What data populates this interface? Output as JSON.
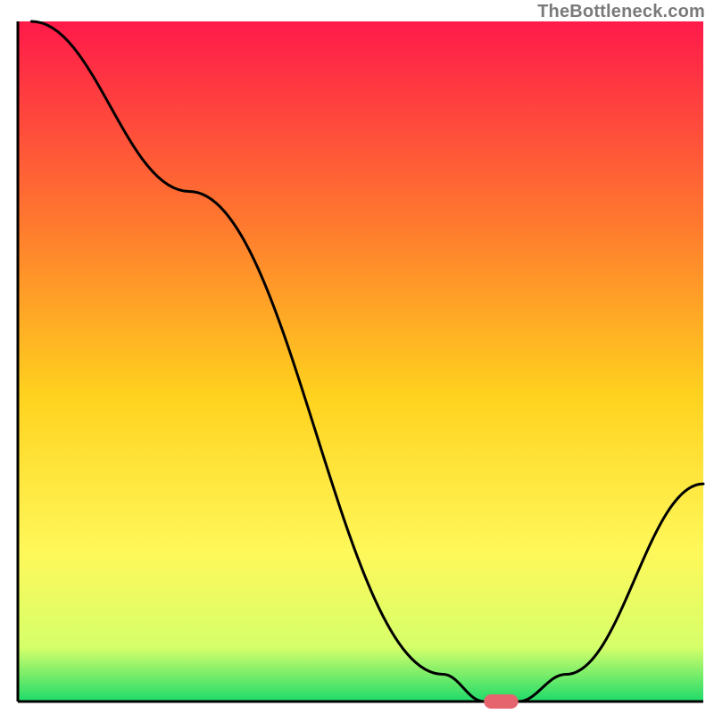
{
  "watermark": "TheBottleneck.com",
  "palette": {
    "gradient_top": "#ff1a4a",
    "gradient_mid1": "#ff7a2e",
    "gradient_mid2": "#ffd21e",
    "gradient_mid3": "#fff85a",
    "gradient_bottom": "#1edb6a",
    "line": "#000000",
    "marker": "#e6646e",
    "frame": "#000000"
  },
  "chart_data": {
    "type": "line",
    "title": "",
    "xlabel": "",
    "ylabel": "",
    "xlim": [
      0,
      100
    ],
    "ylim": [
      0,
      100
    ],
    "x": [
      2,
      25,
      62,
      68,
      73,
      80,
      100
    ],
    "values": [
      100,
      75,
      4,
      0,
      0,
      4,
      32
    ],
    "marker": {
      "x_start": 68,
      "x_end": 73,
      "y": 0
    },
    "annotations": []
  }
}
